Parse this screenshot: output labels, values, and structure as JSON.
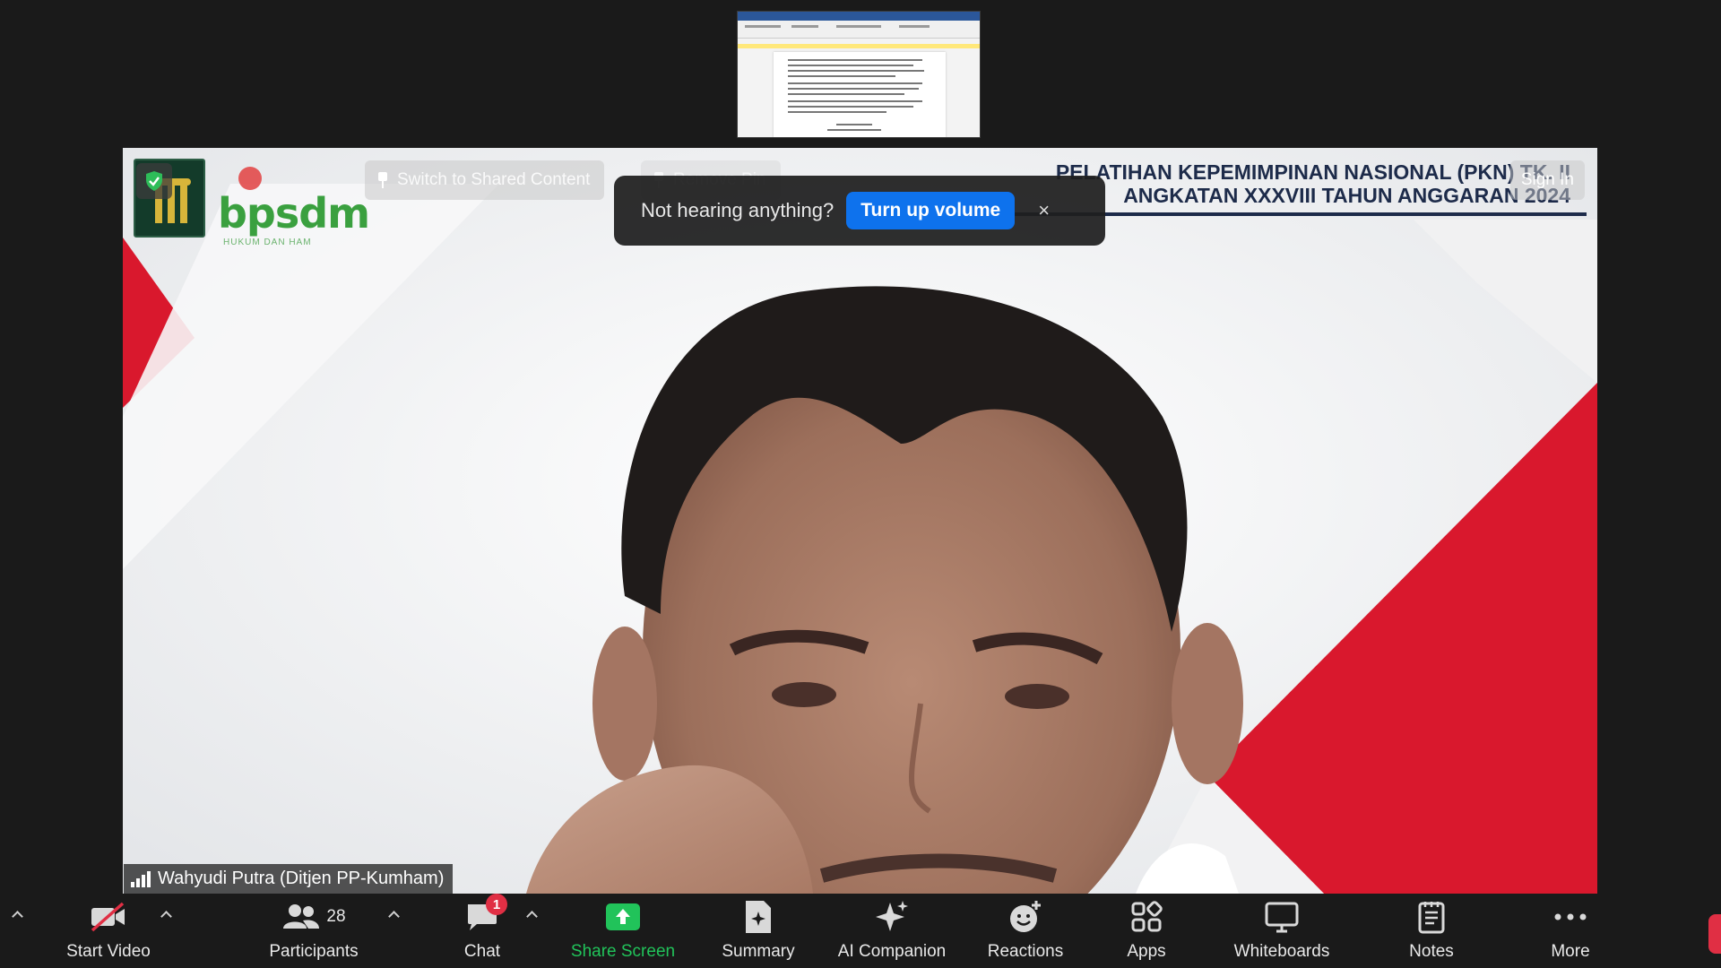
{
  "video": {
    "banner_line1": "PELATIHAN KEPEMIMPINAN NASIONAL (PKN) TK. II",
    "banner_line2": "ANGKATAN XXXVIII TAHUN ANGGARAN 2024",
    "logo_text": "bpsdm",
    "logo_subtext": "HUKUM DAN HAM",
    "participant_name": "Wahyudi Putra (Ditjen PP-Kumham)"
  },
  "overlay": {
    "switch_label": "Switch to Shared Content",
    "remove_pin_label": "Remove Pin",
    "sign_in_label": "Sign In"
  },
  "toast": {
    "message": "Not hearing anything?",
    "action_label": "Turn up volume",
    "close_symbol": "×"
  },
  "toolbar": {
    "start_video": "Start Video",
    "participants": "Participants",
    "participants_count": "28",
    "chat": "Chat",
    "chat_badge": "1",
    "share_screen": "Share Screen",
    "summary": "Summary",
    "ai_companion": "AI Companion",
    "reactions": "Reactions",
    "apps": "Apps",
    "whiteboards": "Whiteboards",
    "notes": "Notes",
    "more": "More"
  },
  "colors": {
    "accent_blue": "#0e72ed",
    "share_green": "#21c35a",
    "badge_red": "#e02f44",
    "banner_red": "#d9182d"
  }
}
